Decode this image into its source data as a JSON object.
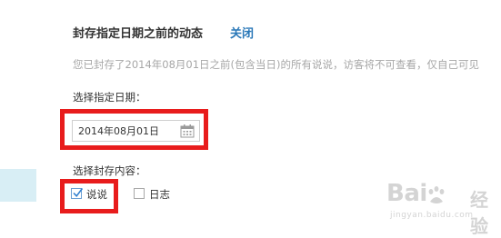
{
  "dialog": {
    "title": "封存指定日期之前的动态",
    "close_label": "关闭",
    "description": "您已封存了2014年08月01日之前(包含当日)的所有说说，访客将不可查看，仅自己可见"
  },
  "date_section": {
    "label": "选择指定日期：",
    "value": "2014年08月01日",
    "icon": "calendar-icon"
  },
  "content_section": {
    "label": "选择封存内容：",
    "options": [
      {
        "label": "说说",
        "checked": true
      },
      {
        "label": "日志",
        "checked": false
      }
    ]
  },
  "watermark": {
    "brand": "Bai",
    "suffix": "经验",
    "url": "jingyan.baidu.com"
  },
  "colors": {
    "accent_link": "#2a78b8",
    "highlight": "#e81c1c",
    "muted_text": "#a7a7a7",
    "side_panel": "#d8eef5"
  }
}
